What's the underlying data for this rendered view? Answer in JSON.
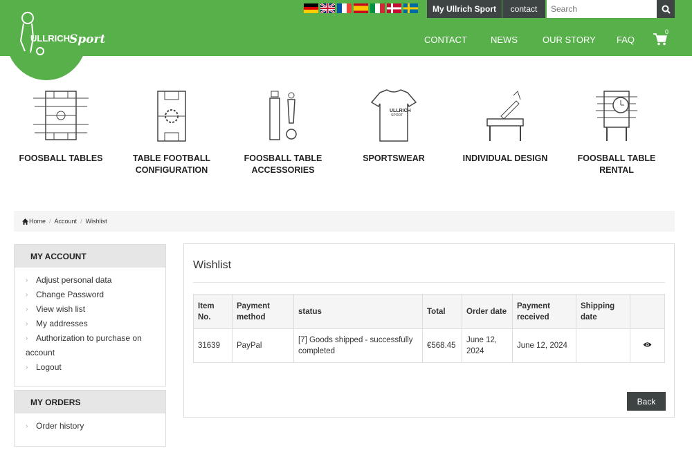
{
  "header": {
    "brand": "ULLRICH Sport",
    "flags": [
      "German",
      "English",
      "French",
      "Spanish",
      "Italian",
      "Danish",
      "Swedish"
    ],
    "my_ullrich_label": "My Ullrich Sport",
    "contact_button_label": "contact",
    "search_placeholder": "Search",
    "nav": [
      "CONTACT",
      "NEWS",
      "OUR STORY",
      "FAQ"
    ],
    "cart_count": "0"
  },
  "categories": [
    {
      "label_line1": "FOOSBALL TABLES",
      "label_line2": "",
      "icon": "foosball-table-icon"
    },
    {
      "label_line1": "TABLE FOOTBALL",
      "label_line2": "CONFIGURATION",
      "icon": "table-config-icon"
    },
    {
      "label_line1": "FOOSBALL TABLE",
      "label_line2": "ACCESSORIES",
      "icon": "accessories-icon"
    },
    {
      "label_line1": "SPORTSWEAR",
      "label_line2": "",
      "icon": "tshirt-icon"
    },
    {
      "label_line1": "INDIVIDUAL DESIGN",
      "label_line2": "",
      "icon": "design-icon"
    },
    {
      "label_line1": "FOOSBALL TABLE",
      "label_line2": "RENTAL",
      "icon": "rental-icon"
    }
  ],
  "breadcrumb": [
    "Home",
    "Account",
    "Wishlist"
  ],
  "sidebar": {
    "account_title": "MY ACCOUNT",
    "account_items": [
      "Adjust personal data",
      "Change Password",
      "View wish list",
      "My addresses",
      "Authorization to purchase on account",
      "Logout"
    ],
    "orders_title": "MY ORDERS",
    "orders_items": [
      "Order history"
    ]
  },
  "main": {
    "title": "Wishlist",
    "columns": [
      "Item No.",
      "Payment method",
      "status",
      "Total",
      "Order date",
      "Payment received",
      "Shipping date",
      ""
    ],
    "rows": [
      {
        "item_no": "31639",
        "payment_method": "PayPal",
        "status": "[7] Goods shipped - successfully completed",
        "total": "€568.45",
        "order_date": "June 12, 2024",
        "payment_received": "June 12, 2024",
        "shipping_date": ""
      }
    ],
    "back_label": "Back"
  },
  "colors": {
    "brand_green": "#57b04a",
    "dark_button": "#3e4444"
  }
}
